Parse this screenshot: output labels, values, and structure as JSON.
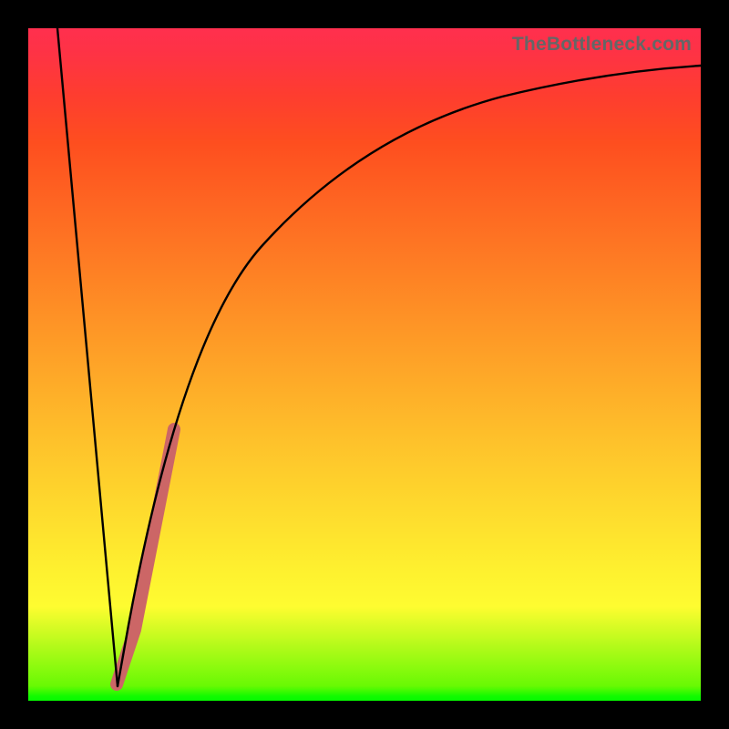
{
  "watermark": "TheBottleneck.com",
  "chart_data": {
    "type": "line",
    "title": "",
    "xlabel": "",
    "ylabel": "",
    "xlim": [
      0,
      100
    ],
    "ylim": [
      0,
      100
    ],
    "grid": false,
    "series": [
      {
        "name": "left-descent",
        "color": "#000000",
        "width": 2,
        "x": [
          4,
          13.5
        ],
        "y": [
          100,
          2
        ]
      },
      {
        "name": "right-curve",
        "color": "#000000",
        "width": 2,
        "x": [
          13.5,
          15,
          18,
          22,
          27,
          33,
          40,
          48,
          58,
          70,
          85,
          100
        ],
        "y": [
          2,
          12,
          28,
          44,
          57,
          67,
          75,
          81,
          85.5,
          89,
          91.5,
          93
        ]
      },
      {
        "name": "highlight-segment",
        "color": "#cc6666",
        "width": 9,
        "x": [
          13.5,
          16,
          21.5
        ],
        "y": [
          3,
          11,
          40
        ]
      }
    ]
  }
}
